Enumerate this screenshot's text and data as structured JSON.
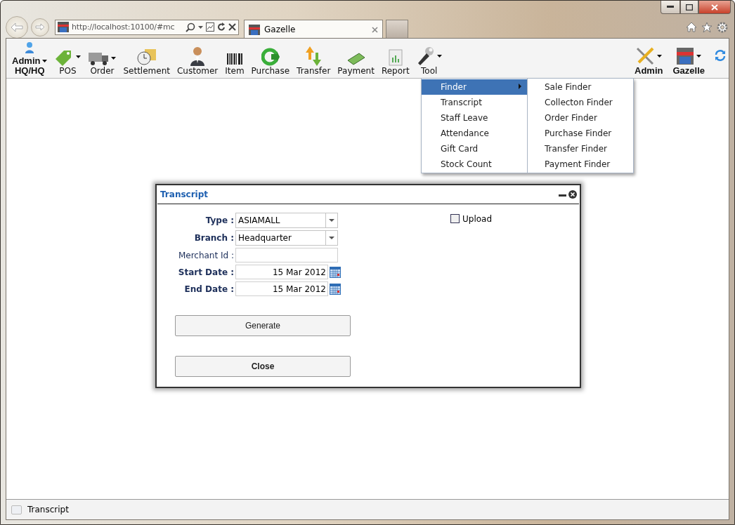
{
  "browser": {
    "address": "http://localhost:10100/#mc",
    "tab_title": "Gazelle"
  },
  "toolbar": {
    "left": [
      {
        "label": "Admin",
        "sublabel": "HQ/HQ",
        "bold": true,
        "dropdown": true
      },
      {
        "label": "POS",
        "bold": false,
        "dropdown": true
      },
      {
        "label": "Order",
        "bold": false,
        "dropdown": true
      },
      {
        "label": "Settlement",
        "bold": false,
        "dropdown": false
      },
      {
        "label": "Customer",
        "bold": false,
        "dropdown": false
      },
      {
        "label": "Item",
        "bold": false,
        "dropdown": false
      },
      {
        "label": "Purchase",
        "bold": false,
        "dropdown": false
      },
      {
        "label": "Transfer",
        "bold": false,
        "dropdown": false
      },
      {
        "label": "Payment",
        "bold": false,
        "dropdown": false
      },
      {
        "label": "Report",
        "bold": false,
        "dropdown": false
      },
      {
        "label": "Tool",
        "bold": false,
        "dropdown": true
      }
    ],
    "right": [
      {
        "label": "Admin",
        "bold": true,
        "dropdown": true
      },
      {
        "label": "Gazelle",
        "bold": true,
        "dropdown": true
      }
    ]
  },
  "tool_menu": {
    "items": [
      {
        "label": "Finder",
        "selected": true,
        "submenu": true
      },
      {
        "label": "Transcript",
        "selected": false,
        "submenu": false
      },
      {
        "label": "Staff Leave",
        "selected": false,
        "submenu": false
      },
      {
        "label": "Attendance",
        "selected": false,
        "submenu": false
      },
      {
        "label": "Gift Card",
        "selected": false,
        "submenu": false
      },
      {
        "label": "Stock Count",
        "selected": false,
        "submenu": false
      }
    ],
    "submenu": [
      "Sale Finder",
      "Collecton Finder",
      "Order Finder",
      "Purchase Finder",
      "Transfer Finder",
      "Payment Finder"
    ]
  },
  "dialog": {
    "title": "Transcript",
    "fields": [
      {
        "kind": "select",
        "label": "Type :",
        "required": true,
        "value": "ASIAMALL"
      },
      {
        "kind": "select",
        "label": "Branch :",
        "required": true,
        "value": "Headquarter"
      },
      {
        "kind": "text",
        "label": "Merchant Id :",
        "required": false
      },
      {
        "kind": "date",
        "label": "Start Date :",
        "required": true,
        "value": "15 Mar 2012"
      },
      {
        "kind": "date",
        "label": "End Date :",
        "required": true,
        "value": "15 Mar 2012"
      }
    ],
    "upload": {
      "label": "Upload",
      "checked": false
    },
    "buttons": [
      {
        "label": "Generate",
        "bold": false
      },
      {
        "label": "Close",
        "bold": true
      }
    ]
  },
  "status_bar": {
    "text": "Transcript"
  }
}
